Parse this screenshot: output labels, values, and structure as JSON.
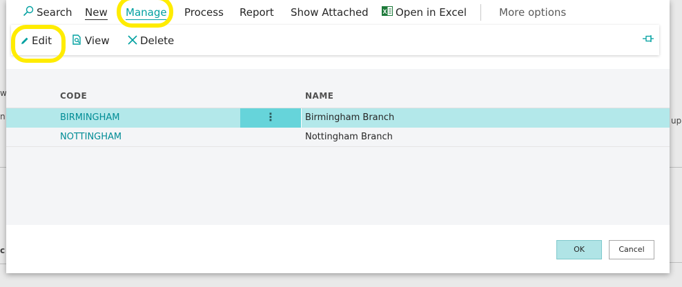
{
  "action_bar": {
    "search_label": "Search",
    "new_label": "New",
    "manage_label": "Manage",
    "process_label": "Process",
    "report_label": "Report",
    "show_attached_label": "Show Attached",
    "open_excel_label": "Open in Excel",
    "more_options_label": "More options"
  },
  "manage_actions": {
    "edit_label": "Edit",
    "view_label": "View",
    "delete_label": "Delete"
  },
  "table": {
    "columns": {
      "code": "CODE",
      "name": "NAME"
    },
    "rows": [
      {
        "code": "BIRMINGHAM",
        "name": "Birmingham Branch",
        "selected": true,
        "menu_glyph": "⋮"
      },
      {
        "code": "NOTTINGHAM",
        "name": "Nottingham Branch",
        "selected": false
      }
    ]
  },
  "footer": {
    "ok_label": "OK",
    "cancel_label": "Cancel"
  },
  "background_fragments": {
    "left_top": "w",
    "left_mid": "n",
    "left_bottom": "c",
    "right_mid": "up"
  },
  "colors": {
    "accent": "#00a0a0",
    "highlight": "#ffec00",
    "selected_row": "#b3e8ea",
    "icon_green": "#1d7a3a"
  }
}
